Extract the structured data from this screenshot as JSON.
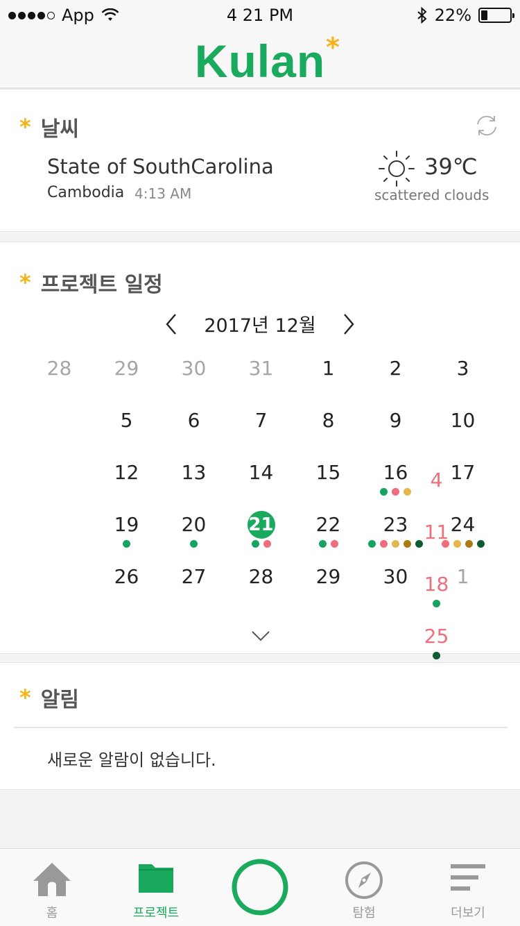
{
  "status_bar": {
    "carrier": "App",
    "time": "4 21 PM",
    "battery": "22%",
    "battery_level": 0.22
  },
  "header": {
    "logo_text": "Kulan",
    "logo_mark": "*"
  },
  "weather": {
    "title": "날씨",
    "city": "State of SouthCarolina",
    "country": "Cambodia",
    "local_time": "4:13 AM",
    "temperature": "39℃",
    "description": "scattered clouds",
    "icon": "sun-icon"
  },
  "schedule": {
    "title": "프로젝트 일정",
    "month_label": "2017년 12월",
    "weeks": [
      [
        {
          "d": "28",
          "t": "muted",
          "dots": []
        },
        {
          "d": "29",
          "t": "muted",
          "dots": []
        },
        {
          "d": "30",
          "t": "muted",
          "dots": []
        },
        {
          "d": "31",
          "t": "muted",
          "dots": []
        },
        {
          "d": "1",
          "t": "",
          "dots": []
        },
        {
          "d": "2",
          "t": "",
          "dots": []
        },
        {
          "d": "3",
          "t": "",
          "dots": []
        }
      ],
      [
        {
          "d": "4",
          "t": "sun",
          "dots": []
        },
        {
          "d": "5",
          "t": "",
          "dots": []
        },
        {
          "d": "6",
          "t": "",
          "dots": []
        },
        {
          "d": "7",
          "t": "",
          "dots": []
        },
        {
          "d": "8",
          "t": "",
          "dots": []
        },
        {
          "d": "9",
          "t": "",
          "dots": []
        },
        {
          "d": "10",
          "t": "",
          "dots": []
        }
      ],
      [
        {
          "d": "11",
          "t": "sun",
          "dots": []
        },
        {
          "d": "12",
          "t": "",
          "dots": []
        },
        {
          "d": "13",
          "t": "",
          "dots": []
        },
        {
          "d": "14",
          "t": "",
          "dots": []
        },
        {
          "d": "15",
          "t": "",
          "dots": []
        },
        {
          "d": "16",
          "t": "",
          "dots": [
            "green",
            "pink",
            "gold"
          ]
        },
        {
          "d": "17",
          "t": "",
          "dots": []
        }
      ],
      [
        {
          "d": "18",
          "t": "sun",
          "dots": [
            "green"
          ]
        },
        {
          "d": "19",
          "t": "",
          "dots": [
            "green"
          ]
        },
        {
          "d": "20",
          "t": "",
          "dots": [
            "green"
          ]
        },
        {
          "d": "21",
          "t": "today",
          "dots": [
            "green",
            "pink"
          ]
        },
        {
          "d": "22",
          "t": "",
          "dots": [
            "green",
            "pink"
          ]
        },
        {
          "d": "23",
          "t": "",
          "dots": [
            "green",
            "pink",
            "gold",
            "olive",
            "darkgreen"
          ]
        },
        {
          "d": "24",
          "t": "",
          "dots": [
            "pink",
            "gold",
            "olive",
            "darkgreen"
          ]
        }
      ],
      [
        {
          "d": "25",
          "t": "sun",
          "dots": [
            "darkgreen"
          ]
        },
        {
          "d": "26",
          "t": "",
          "dots": []
        },
        {
          "d": "27",
          "t": "",
          "dots": []
        },
        {
          "d": "28",
          "t": "",
          "dots": []
        },
        {
          "d": "29",
          "t": "",
          "dots": []
        },
        {
          "d": "30",
          "t": "",
          "dots": []
        },
        {
          "d": "1",
          "t": "muted",
          "dots": []
        }
      ]
    ]
  },
  "notifications": {
    "title": "알림",
    "empty_message": "새로운 알람이 없습니다."
  },
  "tabs": [
    {
      "label": "홈",
      "icon": "home-icon",
      "active": false
    },
    {
      "label": "프로젝트",
      "icon": "folder-icon",
      "active": true
    },
    {
      "label": "",
      "icon": "circle-button-icon",
      "active": false
    },
    {
      "label": "탐험",
      "icon": "compass-icon",
      "active": false
    },
    {
      "label": "더보기",
      "icon": "menu-icon",
      "active": false
    }
  ],
  "colors": {
    "brand_green": "#1aaa5e",
    "accent_star": "#f4b41a",
    "sunday_red": "#ee6e7c",
    "dot_green": "#16a35f",
    "dot_pink": "#ee6e7c",
    "dot_gold": "#e3b74e",
    "dot_olive": "#a67d12",
    "dot_darkgreen": "#0d5a34"
  }
}
